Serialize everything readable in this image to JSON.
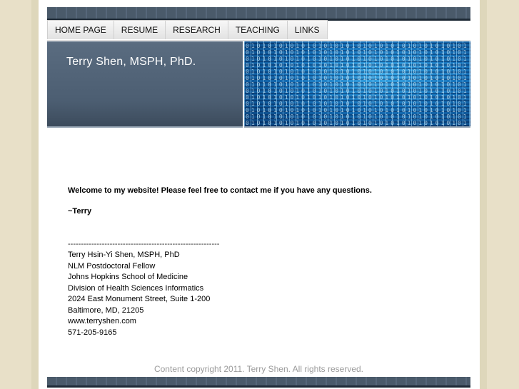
{
  "nav": {
    "items": [
      {
        "label": "HOME PAGE"
      },
      {
        "label": "RESUME"
      },
      {
        "label": "RESEARCH"
      },
      {
        "label": "TEACHING"
      },
      {
        "label": "LINKS"
      }
    ]
  },
  "banner": {
    "title": "Terry Shen, MSPH, PhD."
  },
  "content": {
    "welcome": "Welcome to my website!  Please feel free to contact me if you have any questions.",
    "signature": "~Terry",
    "rule": "----------------------------------------------------------",
    "address": [
      "Terry Hsin-Yi Shen, MSPH, PhD",
      "NLM Postdoctoral Fellow",
      "Johns Hopkins School of Medicine",
      "Division of Health Sciences Informatics",
      "2024 East Monument Street, Suite 1-200",
      "Baltimore, MD, 21205",
      "www.terryshen.com",
      "571-205-9165"
    ]
  },
  "footer": {
    "copyright": "Content copyright 2011. Terry Shen. All rights reserved."
  },
  "colors": {
    "banner_left": "#4c5e72",
    "banner_right": "#1570b8",
    "page_background": "#e8e0c8",
    "footer_text": "#9a9a9a"
  }
}
